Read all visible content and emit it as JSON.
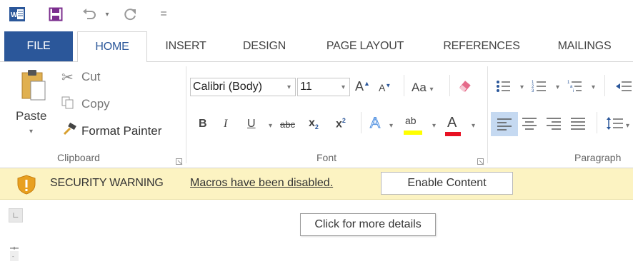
{
  "quick_access": {
    "icons": [
      "word-app-icon",
      "save-icon",
      "undo-icon",
      "redo-icon",
      "customize-qat-icon"
    ],
    "customize_label": "="
  },
  "tabs": [
    {
      "label": "FILE"
    },
    {
      "label": "HOME"
    },
    {
      "label": "INSERT"
    },
    {
      "label": "DESIGN"
    },
    {
      "label": "PAGE LAYOUT"
    },
    {
      "label": "REFERENCES"
    },
    {
      "label": "MAILINGS"
    }
  ],
  "active_tab": "HOME",
  "clipboard": {
    "paste_label": "Paste",
    "cut_label": "Cut",
    "copy_label": "Copy",
    "format_painter_label": "Format Painter",
    "group_label": "Clipboard"
  },
  "font": {
    "font_name": "Calibri (Body)",
    "font_size": "11",
    "bold_label": "B",
    "italic_label": "I",
    "underline_label": "U",
    "strikethrough_label": "abc",
    "subscript_label": "x",
    "subscript_sub": "2",
    "superscript_label": "x",
    "superscript_sup": "2",
    "change_case_label": "Aa",
    "grow_font_label": "A",
    "shrink_font_label": "A",
    "text_effects_label": "A",
    "highlight_label": "ab",
    "font_color_label": "A",
    "group_label": "Font",
    "highlight_color": "#ffff00",
    "font_color": "#e81123"
  },
  "paragraph": {
    "group_label": "Paragraph"
  },
  "security_bar": {
    "title": "SECURITY WARNING",
    "message": "Macros have been disabled.",
    "button_label": "Enable Content",
    "background": "#fcf3c2"
  },
  "tooltip": {
    "text": "Click for more details"
  },
  "colors": {
    "file_tab": "#2b579a",
    "accent": "#2b579a"
  }
}
